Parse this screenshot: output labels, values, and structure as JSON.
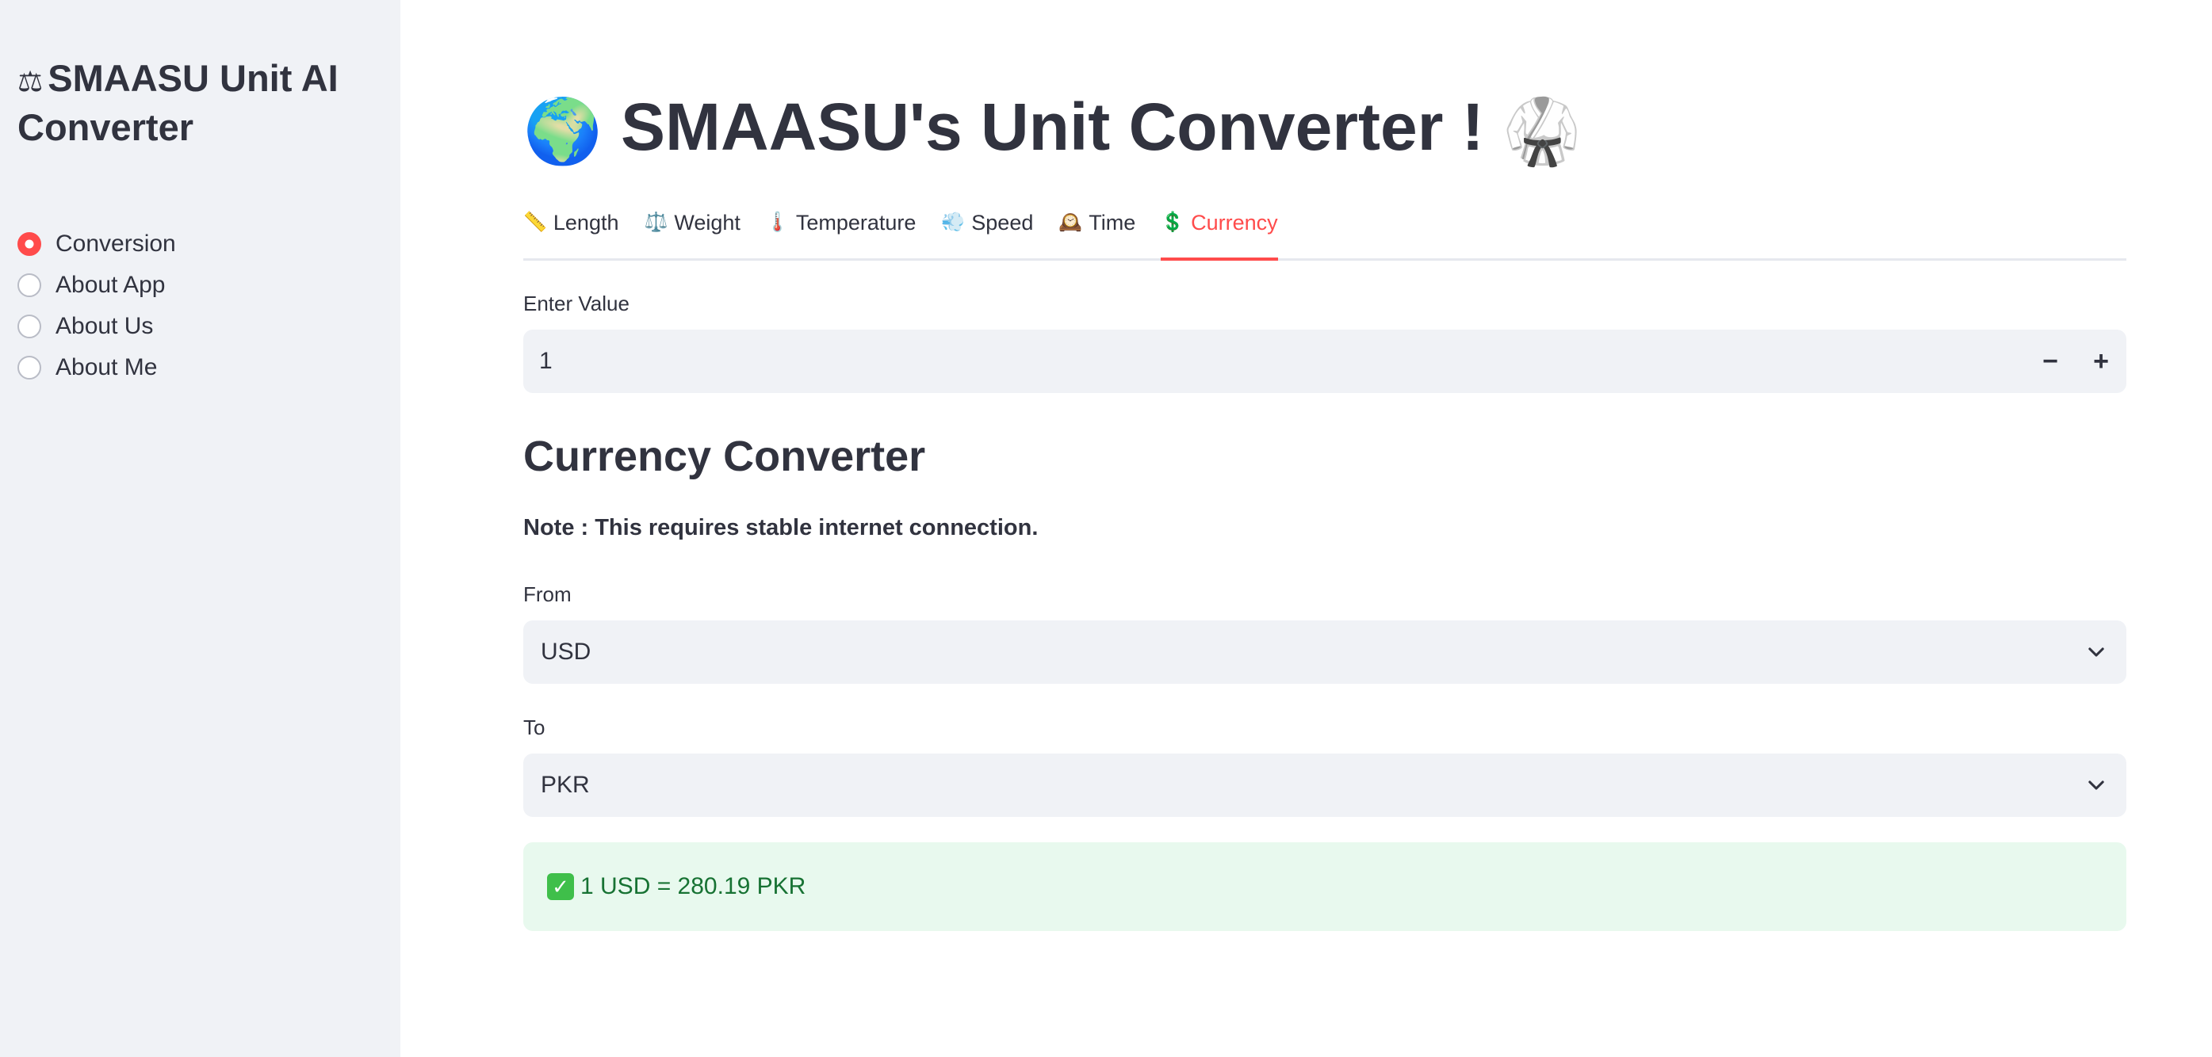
{
  "sidebar": {
    "title_icon": "⚖",
    "title": "SMAASU Unit AI Converter",
    "items": [
      {
        "label": "Conversion",
        "checked": true
      },
      {
        "label": "About App",
        "checked": false
      },
      {
        "label": "About Us",
        "checked": false
      },
      {
        "label": "About Me",
        "checked": false
      }
    ]
  },
  "header": {
    "title_emoji_left": "🌍",
    "title": "SMAASU's Unit Converter !",
    "title_emoji_right": "🥋"
  },
  "tabs": [
    {
      "icon": "📏",
      "icon_name": "ruler-icon",
      "label": "Length",
      "active": false
    },
    {
      "icon": "⚖️",
      "icon_name": "scale-icon",
      "label": "Weight",
      "active": false
    },
    {
      "icon": "🌡️",
      "icon_name": "thermometer-icon",
      "label": "Temperature",
      "active": false
    },
    {
      "icon": "💨",
      "icon_name": "wind-icon",
      "label": "Speed",
      "active": false
    },
    {
      "icon": "🕰️",
      "icon_name": "clock-icon",
      "label": "Time",
      "active": false
    },
    {
      "icon": "💲",
      "icon_name": "dollar-icon",
      "label": "Currency",
      "active": true
    }
  ],
  "value_input": {
    "label": "Enter Value",
    "value": "1",
    "decrement": "−",
    "increment": "+"
  },
  "converter": {
    "heading": "Currency Converter",
    "note": "Note : This requires stable internet connection.",
    "from_label": "From",
    "from_value": "USD",
    "to_label": "To",
    "to_value": "PKR",
    "result_icon": "✓",
    "result": "1 USD = 280.19 PKR"
  },
  "colors": {
    "accent": "#ff4b4b",
    "sidebar_bg": "#f0f2f6",
    "success_bg": "#e8f9ee",
    "success_text": "#177233"
  }
}
